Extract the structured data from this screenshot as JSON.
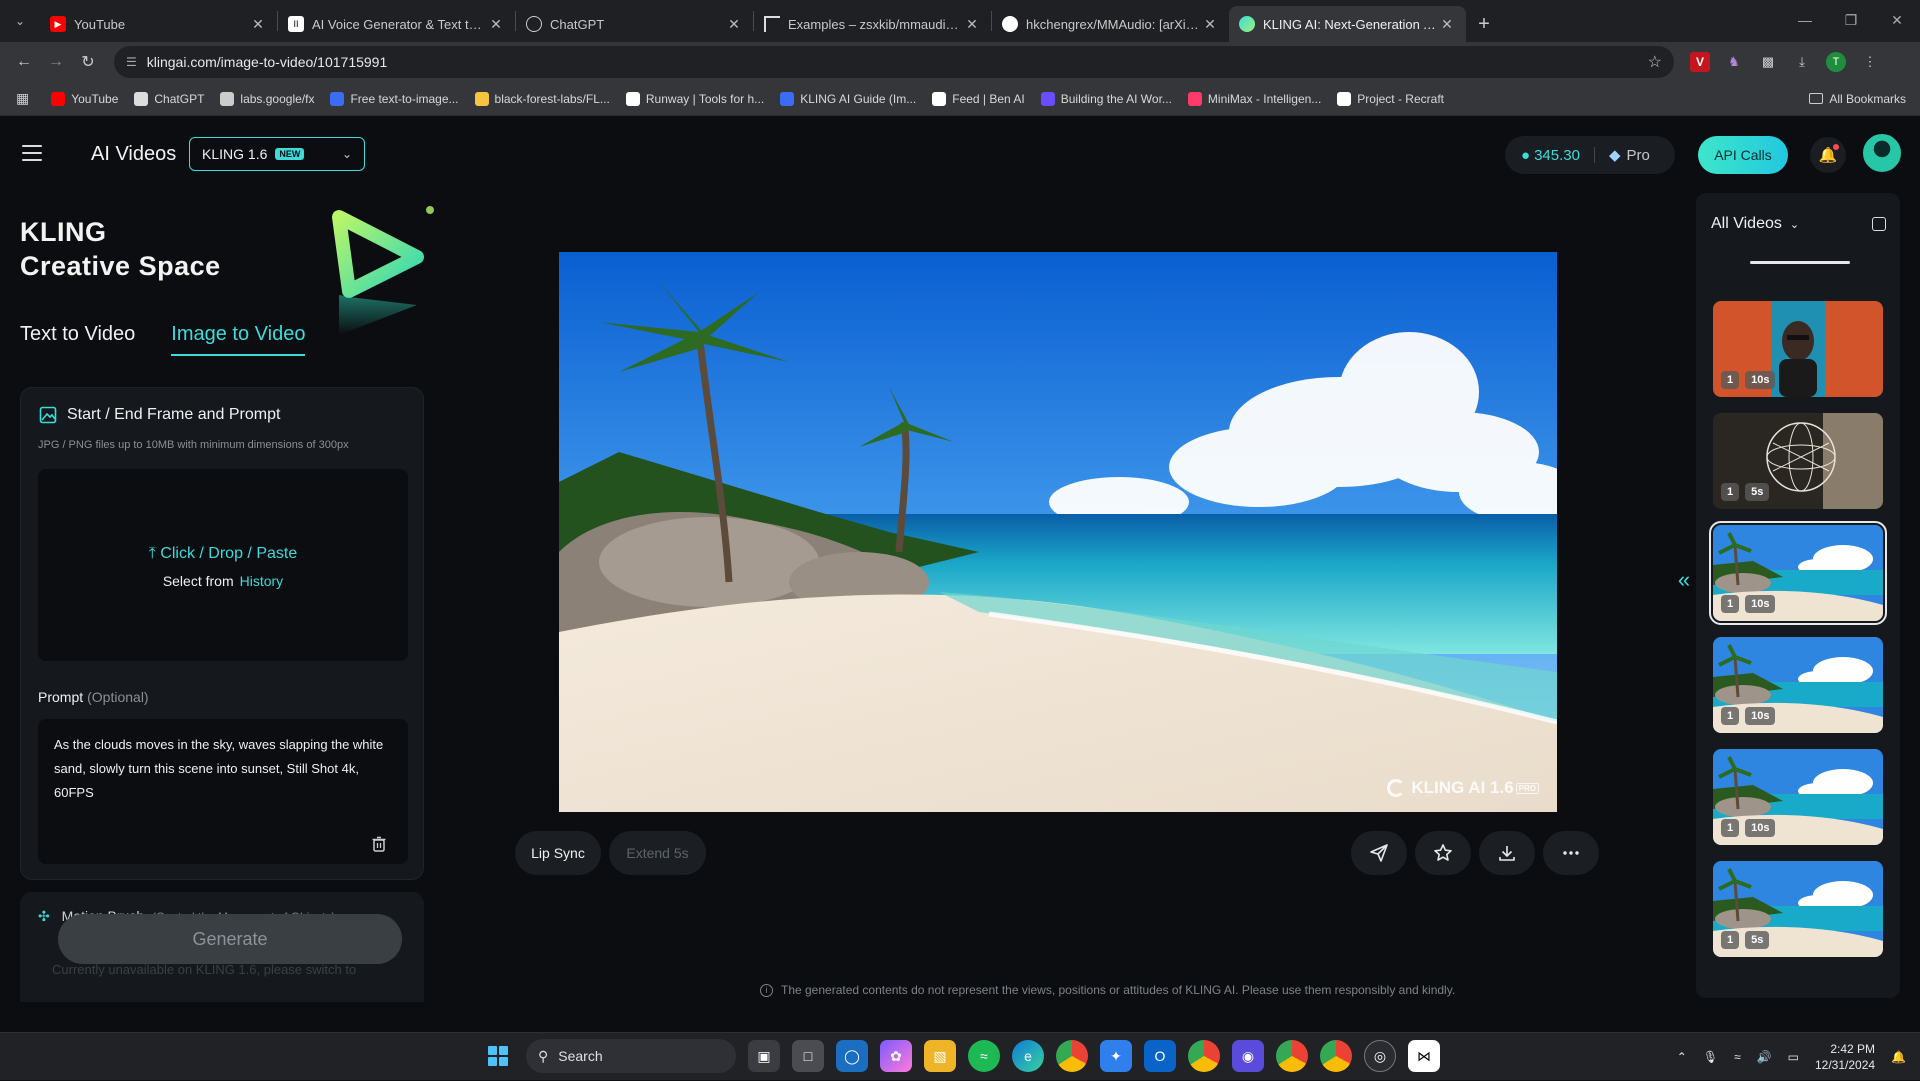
{
  "browser": {
    "tabs": [
      {
        "title": "YouTube",
        "favicon": "youtube-icon",
        "active": false
      },
      {
        "title": "AI Voice Generator & Text to Sp",
        "favicon": "elevenlabs-icon",
        "active": false
      },
      {
        "title": "ChatGPT",
        "favicon": "chatgpt-icon",
        "active": false
      },
      {
        "title": "Examples – zsxkib/mmaudio – F",
        "favicon": "replicate-icon",
        "active": false
      },
      {
        "title": "hkchengrex/MMAudio: [arXiv 2",
        "favicon": "github-icon",
        "active": false
      },
      {
        "title": "KLING AI: Next-Generation AI C",
        "favicon": "kling-icon",
        "active": true
      }
    ],
    "url": "klingai.com/image-to-video/101715991",
    "bookmarks": [
      {
        "label": "YouTube",
        "color": "#ff0000"
      },
      {
        "label": "ChatGPT",
        "color": "#dddddd"
      },
      {
        "label": "labs.google/fx",
        "color": "#cccccc"
      },
      {
        "label": "Free text-to-image...",
        "color": "#3b6cf6"
      },
      {
        "label": "black-forest-labs/FL...",
        "color": "#f5c542"
      },
      {
        "label": "Runway | Tools for h...",
        "color": "#ffffff"
      },
      {
        "label": "KLING AI Guide (Im...",
        "color": "#3b6cf6"
      },
      {
        "label": "Feed | Ben AI",
        "color": "#ffffff"
      },
      {
        "label": "Building the AI Wor...",
        "color": "#6a4cff"
      },
      {
        "label": "MiniMax - Intelligen...",
        "color": "#ff3b6b"
      },
      {
        "label": "Project - Recraft",
        "color": "#ffffff"
      }
    ],
    "all_bookmarks": "All Bookmarks"
  },
  "header": {
    "title": "AI Videos",
    "model": "KLING 1.6",
    "model_badge": "NEW",
    "credits": "345.30",
    "plan": "Pro",
    "api_button": "API Calls"
  },
  "left": {
    "brand_line1": "KLING",
    "brand_line2": "Creative Space",
    "tabs": [
      "Text to Video",
      "Image to Video"
    ],
    "active_tab": "Image to Video",
    "section_title": "Start / End Frame and Prompt",
    "section_sub": "JPG / PNG files up to 10MB with minimum dimensions of 300px",
    "upload_action": "Click / Drop / Paste",
    "upload_select": "Select from",
    "upload_history": "History",
    "prompt_label": "Prompt",
    "prompt_optional": "(Optional)",
    "prompt_text": "As the clouds moves in the sky, waves slapping the white sand, slowly turn this scene into sunset, Still Shot 4k, 60FPS",
    "motion_brush_title": "Motion Brush",
    "motion_brush_sub": "(Control the Movement of Objects)",
    "motion_brush_unavailable": "Currently unavailable on KLING 1.6, please switch to",
    "generate": "Generate"
  },
  "center": {
    "watermark": "KLING AI 1.6",
    "watermark_badge": "PRO",
    "lip_sync": "Lip Sync",
    "extend": "Extend 5s",
    "disclaimer": "The generated contents do not represent the views, positions or attitudes of KLING AI. Please use them responsibly and kindly."
  },
  "right": {
    "filter": "All Videos",
    "videos": [
      {
        "count": "1",
        "duration": "10s",
        "kind": "portrait",
        "selected": false
      },
      {
        "count": "1",
        "duration": "5s",
        "kind": "sphere",
        "selected": false
      },
      {
        "count": "1",
        "duration": "10s",
        "kind": "beach",
        "selected": true
      },
      {
        "count": "1",
        "duration": "10s",
        "kind": "beach",
        "selected": false
      },
      {
        "count": "1",
        "duration": "10s",
        "kind": "beach",
        "selected": false
      },
      {
        "count": "1",
        "duration": "5s",
        "kind": "beach",
        "selected": false
      }
    ]
  },
  "taskbar": {
    "search": "Search",
    "time": "2:42 PM",
    "date": "12/31/2024"
  },
  "colors": {
    "accent": "#3ddbd9",
    "panel": "#15191d",
    "bg": "#0b0d10"
  }
}
